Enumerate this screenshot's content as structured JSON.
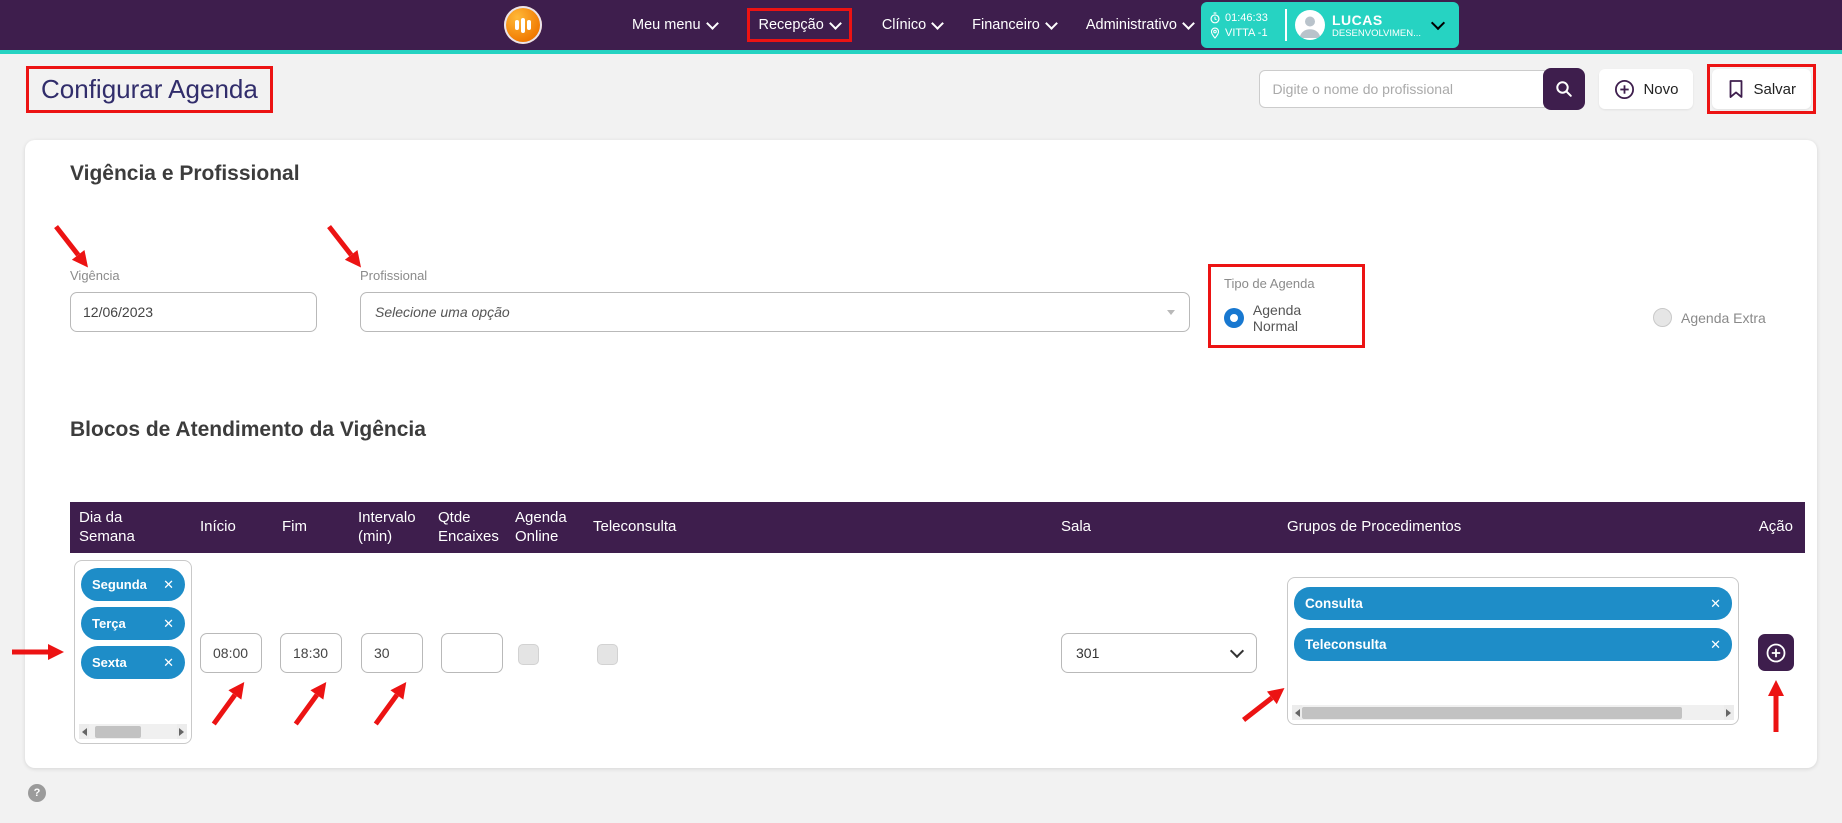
{
  "topbar": {
    "menus": [
      "Meu menu",
      "Recepção",
      "Clínico",
      "Financeiro",
      "Administrativo"
    ],
    "user": {
      "time": "01:46:33",
      "location": "VITTA -1",
      "name": "LUCAS",
      "org": "DESENVOLVIMEN..."
    }
  },
  "header": {
    "title": "Configurar Agenda",
    "search_placeholder": "Digite o nome do profissional",
    "novo": "Novo",
    "salvar": "Salvar"
  },
  "vigencia": {
    "section_title": "Vigência e Profissional",
    "vigencia_label": "Vigência",
    "vigencia_value": "12/06/2023",
    "profissional_label": "Profissional",
    "profissional_value": "Selecione uma opção",
    "tipo_label": "Tipo de Agenda",
    "agenda_normal": "Agenda Normal",
    "agenda_extra": "Agenda Extra"
  },
  "blocos": {
    "section_title": "Blocos de Atendimento da Vigência",
    "columns": [
      "Dia da Semana",
      "Início",
      "Fim",
      "Intervalo (min)",
      "Qtde Encaixes",
      "Agenda Online",
      "Teleconsulta",
      "Sala",
      "Grupos de Procedimentos",
      "Ação"
    ],
    "row": {
      "dias": [
        "Segunda",
        "Terça",
        "Sexta"
      ],
      "inicio": "08:00",
      "fim": "18:30",
      "intervalo": "30",
      "qtde": "",
      "sala": "301",
      "grupos": [
        "Consulta",
        "Teleconsulta"
      ]
    }
  },
  "icons": {
    "close": "✕"
  },
  "colors": {
    "topbar_purple": "#3E1E4D",
    "accent_teal": "#26D3C2",
    "chip_blue": "#1E8DC8",
    "radio_blue": "#1878D0",
    "annotation_red": "#EC1313",
    "title_indigo": "#312D6B"
  },
  "help": "?"
}
